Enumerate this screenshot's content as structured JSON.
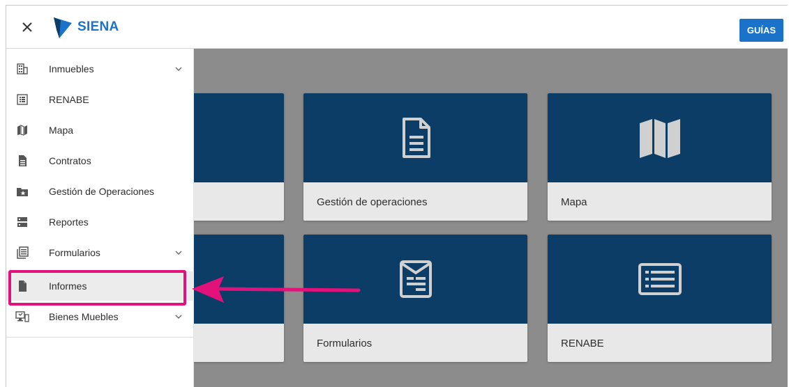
{
  "app": {
    "brand": "SIENA",
    "guide_button": "GUÍAS",
    "colors": {
      "brand_blue": "#1a73c8",
      "card_blue": "#0c3d66",
      "highlight": "#e3117a"
    }
  },
  "sidebar": {
    "items": [
      {
        "label": "Inmuebles",
        "icon": "building-icon",
        "expandable": true
      },
      {
        "label": "RENABE",
        "icon": "list-icon",
        "expandable": false
      },
      {
        "label": "Mapa",
        "icon": "map-icon",
        "expandable": false
      },
      {
        "label": "Contratos",
        "icon": "document-icon",
        "expandable": false
      },
      {
        "label": "Gestión de Operaciones",
        "icon": "folder-star-icon",
        "expandable": false
      },
      {
        "label": "Reportes",
        "icon": "server-icon",
        "expandable": false
      },
      {
        "label": "Formularios",
        "icon": "forms-icon",
        "expandable": true
      },
      {
        "label": "Informes",
        "icon": "file-icon",
        "expandable": false,
        "selected": true
      },
      {
        "label": "Bienes Muebles",
        "icon": "desktop-icon",
        "expandable": true
      }
    ]
  },
  "cards": [
    {
      "label": "",
      "icon": ""
    },
    {
      "label": "Gestión de operaciones",
      "icon": "document-lines-icon"
    },
    {
      "label": "Mapa",
      "icon": "map-icon"
    },
    {
      "label": "",
      "icon": ""
    },
    {
      "label": "Formularios",
      "icon": "form-envelope-icon"
    },
    {
      "label": "RENABE",
      "icon": "list-box-icon"
    }
  ]
}
